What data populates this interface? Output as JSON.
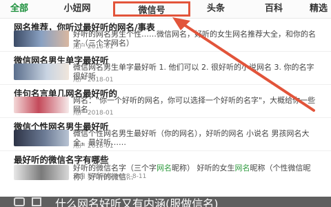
{
  "tabs": [
    {
      "label": "全部"
    },
    {
      "label": "小妞网"
    },
    {
      "label": "微信号"
    },
    {
      "label": "头条"
    },
    {
      "label": "百科"
    },
    {
      "label": "精选"
    }
  ],
  "articles": [
    {
      "title": "网名推荐，你听过最好听的网名/事表",
      "text": "好听的网名男生个性……微信网名，好听的女生网名推荐大全，和你的名字（三个字网名）",
      "meta": "用户 2018-01"
    },
    {
      "title": "微信网名男生单字最好听",
      "text": "微信网名男生单字最好听 1. 他们可以 2. 很好听的小说网名 3. 你的名字很好听",
      "meta": "用户 2018-01"
    },
    {
      "title": "佳句名言单几网名最好听的",
      "text": "网名：\"你一个好听的网名，你可以选择一个好听的名字\"，大概给你一些网名",
      "meta": "用户 2018-01"
    },
    {
      "title": "微信个性网名男生最好听",
      "text": "微信个性网名男生最好听（你的网名），好听的网名 小说名 男孩网名大全，最好听……",
      "meta": "用户 2018-01"
    },
    {
      "title": "最好听的微信名字有哪些",
      "text_parts": [
        "好听的微信名字（三个字",
        "网名",
        "昵称） 好听的女生",
        "网名",
        "昵称（个性微信昵称）好听的微信..."
      ],
      "meta": "来自 好听网名 2018-8-11"
    }
  ],
  "banner": {
    "text": "什么网名好听又有内涵(服做信名)"
  },
  "colors": {
    "accent_green": "#1a8f3a",
    "highlight_red": "#e2543a",
    "arrow_red": "#e2543a"
  }
}
